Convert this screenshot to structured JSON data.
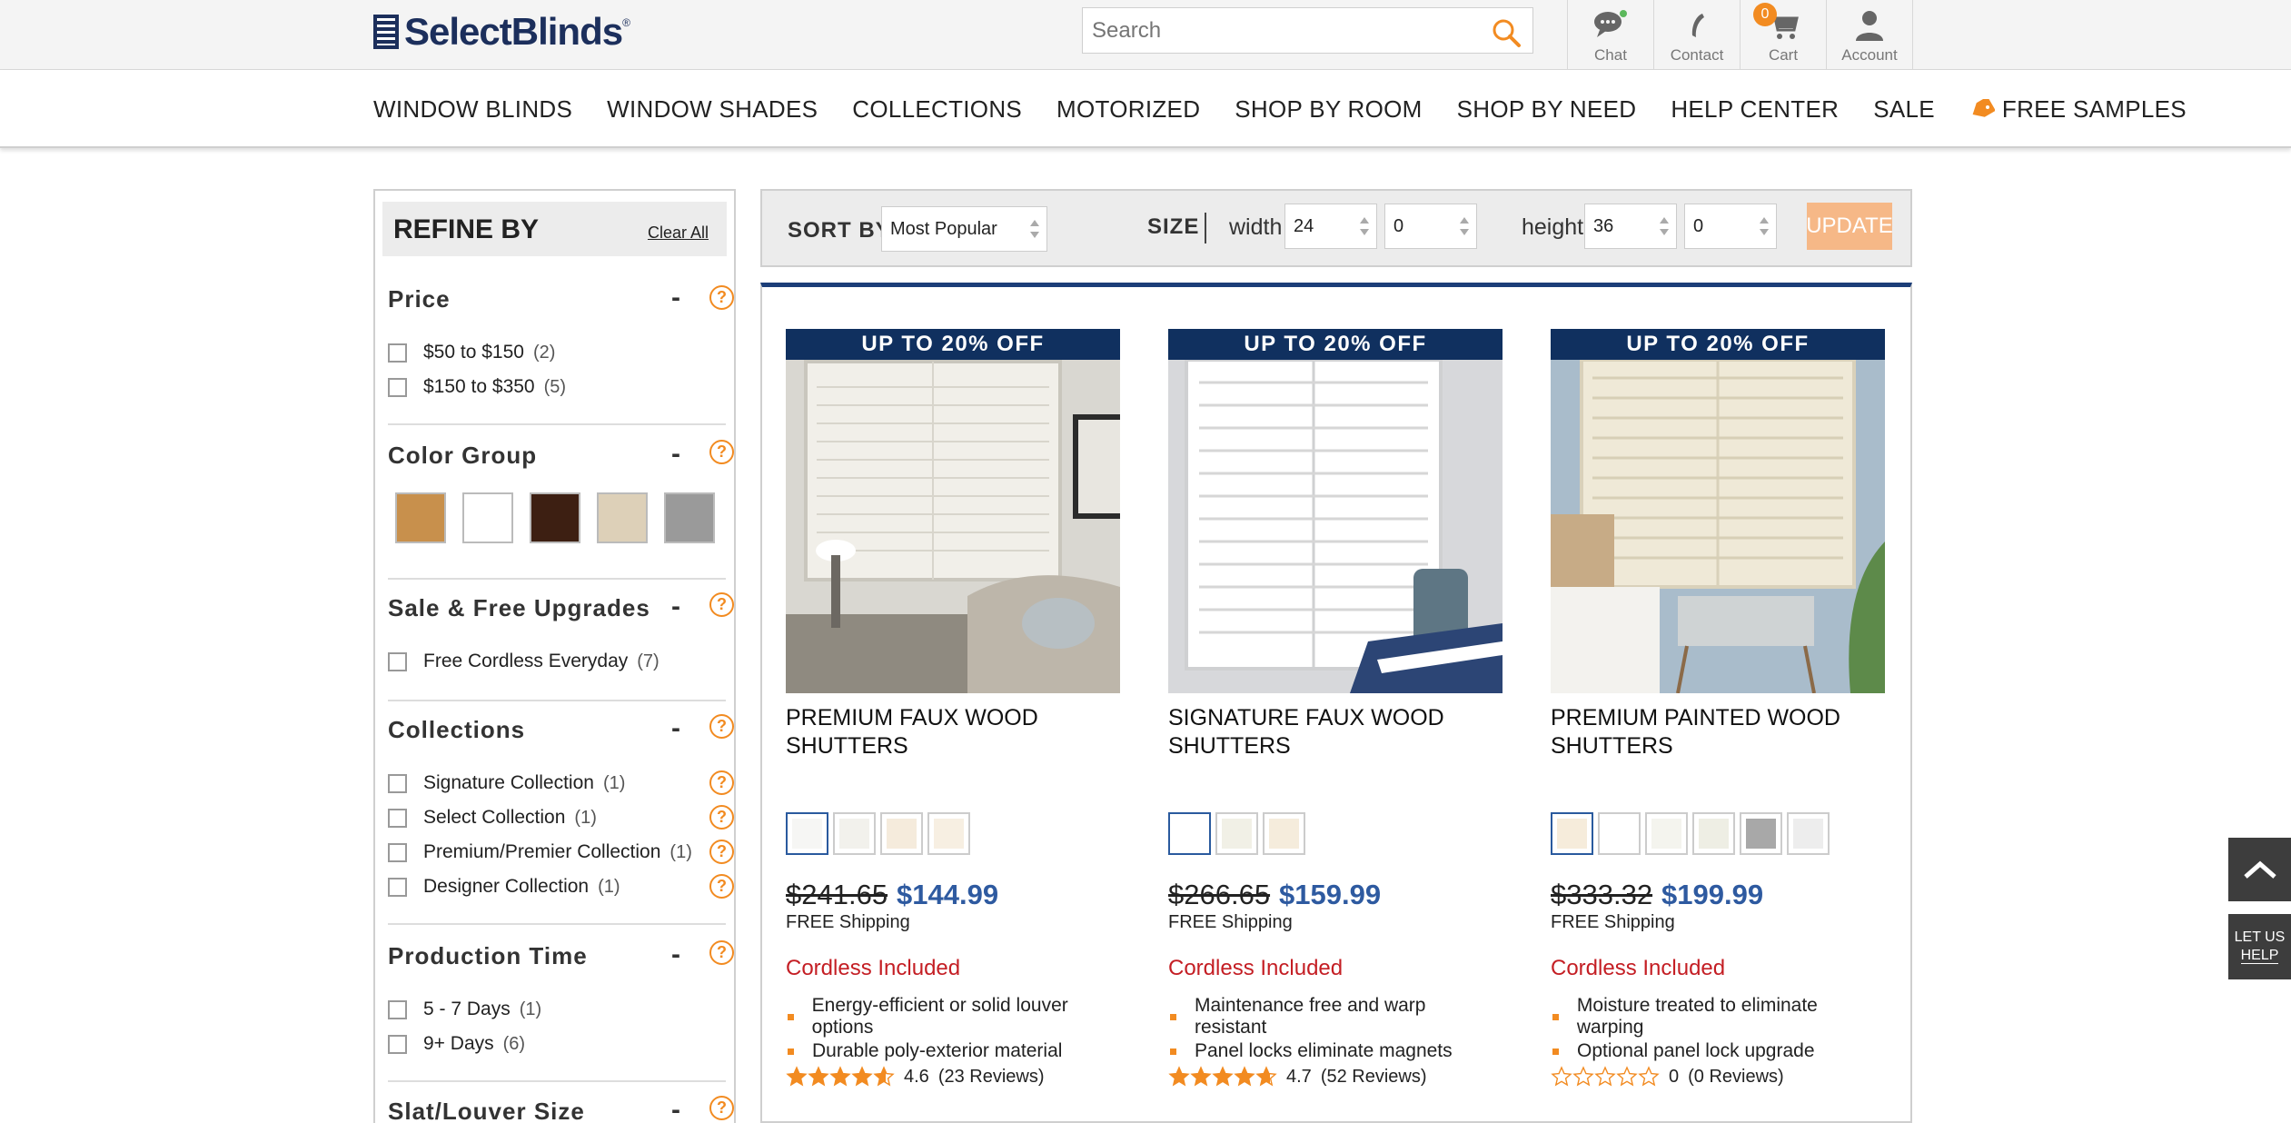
{
  "header": {
    "logo_text": "SelectBlinds",
    "logo_reg": "®",
    "search_placeholder": "Search",
    "icons": [
      {
        "label": "Chat",
        "icon": "chat-icon"
      },
      {
        "label": "Contact",
        "icon": "phone-icon"
      },
      {
        "label": "Cart",
        "icon": "cart-icon"
      },
      {
        "label": "Account",
        "icon": "account-icon"
      }
    ],
    "cart_count": "0"
  },
  "nav": {
    "items": [
      "WINDOW BLINDS",
      "WINDOW SHADES",
      "COLLECTIONS",
      "MOTORIZED",
      "SHOP BY ROOM",
      "SHOP BY NEED",
      "HELP CENTER",
      "SALE"
    ],
    "samples_label": "FREE SAMPLES"
  },
  "sidebar": {
    "title": "REFINE BY",
    "clear_all": "Clear All",
    "price": {
      "title": "Price",
      "options": [
        {
          "label": "$50 to $150",
          "count": "(2)"
        },
        {
          "label": "$150 to $350",
          "count": "(5)"
        }
      ]
    },
    "color_group": {
      "title": "Color Group",
      "swatches": [
        "#c8904c",
        "#ffffff",
        "#3d1f12",
        "#ddd0b8",
        "#9a9a9a"
      ]
    },
    "sale": {
      "title": "Sale & Free Upgrades",
      "options": [
        {
          "label": "Free Cordless Everyday",
          "count": "(7)"
        }
      ]
    },
    "collections": {
      "title": "Collections",
      "options": [
        {
          "label": "Signature Collection",
          "count": "(1)"
        },
        {
          "label": "Select Collection",
          "count": "(1)"
        },
        {
          "label": "Premium/Premier Collection",
          "count": "(1)"
        },
        {
          "label": "Designer Collection",
          "count": "(1)"
        }
      ]
    },
    "production_time": {
      "title": "Production Time",
      "options": [
        {
          "label": "5 - 7 Days",
          "count": "(1)"
        },
        {
          "label": "9+ Days",
          "count": "(6)"
        }
      ]
    },
    "slat_size": {
      "title": "Slat/Louver Size"
    }
  },
  "sortbar": {
    "sort_label": "SORT BY",
    "sort_value": "Most Popular",
    "size_label": "SIZE",
    "width_label": "width",
    "width_value": "24",
    "width_fraction": "0",
    "height_label": "height",
    "height_value": "36",
    "height_fraction": "0",
    "update_label": "UPDATE"
  },
  "products": [
    {
      "promo": "UP TO 20% OFF",
      "name": "PREMIUM FAUX WOOD SHUTTERS",
      "swatches": [
        "#f6f6f4",
        "#f2f1ec",
        "#f5ebdc",
        "#f7efe2"
      ],
      "old_price": "$241.65",
      "new_price": "$144.99",
      "shipping": "FREE Shipping",
      "cordless": "Cordless Included",
      "bullets": [
        "Energy-efficient or solid louver options",
        "Durable poly-exterior material"
      ],
      "rating": 4.6,
      "rating_text": "4.6",
      "reviews": "(23 Reviews)"
    },
    {
      "promo": "UP TO 20% OFF",
      "name": "SIGNATURE FAUX WOOD SHUTTERS",
      "swatches": [
        "#ffffff",
        "#f1f0e6",
        "#f5ecdc"
      ],
      "old_price": "$266.65",
      "new_price": "$159.99",
      "shipping": "FREE Shipping",
      "cordless": "Cordless Included",
      "bullets": [
        "Maintenance free and warp resistant",
        "Panel locks eliminate magnets"
      ],
      "rating": 4.7,
      "rating_text": "4.7",
      "reviews": "(52 Reviews)"
    },
    {
      "promo": "UP TO 20% OFF",
      "name": "PREMIUM PAINTED WOOD SHUTTERS",
      "swatches": [
        "#f6ecdb",
        "#ffffff",
        "#f4f4ee",
        "#eeeee4",
        "#a8a8a8",
        "#ededed"
      ],
      "old_price": "$333.32",
      "new_price": "$199.99",
      "shipping": "FREE Shipping",
      "cordless": "Cordless Included",
      "bullets": [
        "Moisture treated to eliminate warping",
        "Optional panel lock upgrade"
      ],
      "rating": 0,
      "rating_text": "0",
      "reviews": "(0 Reviews)"
    }
  ],
  "floating": {
    "help_line1": "LET US",
    "help_line2": "HELP"
  },
  "colors": {
    "brand_navy": "#1c2f5c",
    "accent_orange": "#f28b21",
    "price_blue": "#2e5aa0",
    "sale_red": "#c41e24"
  }
}
